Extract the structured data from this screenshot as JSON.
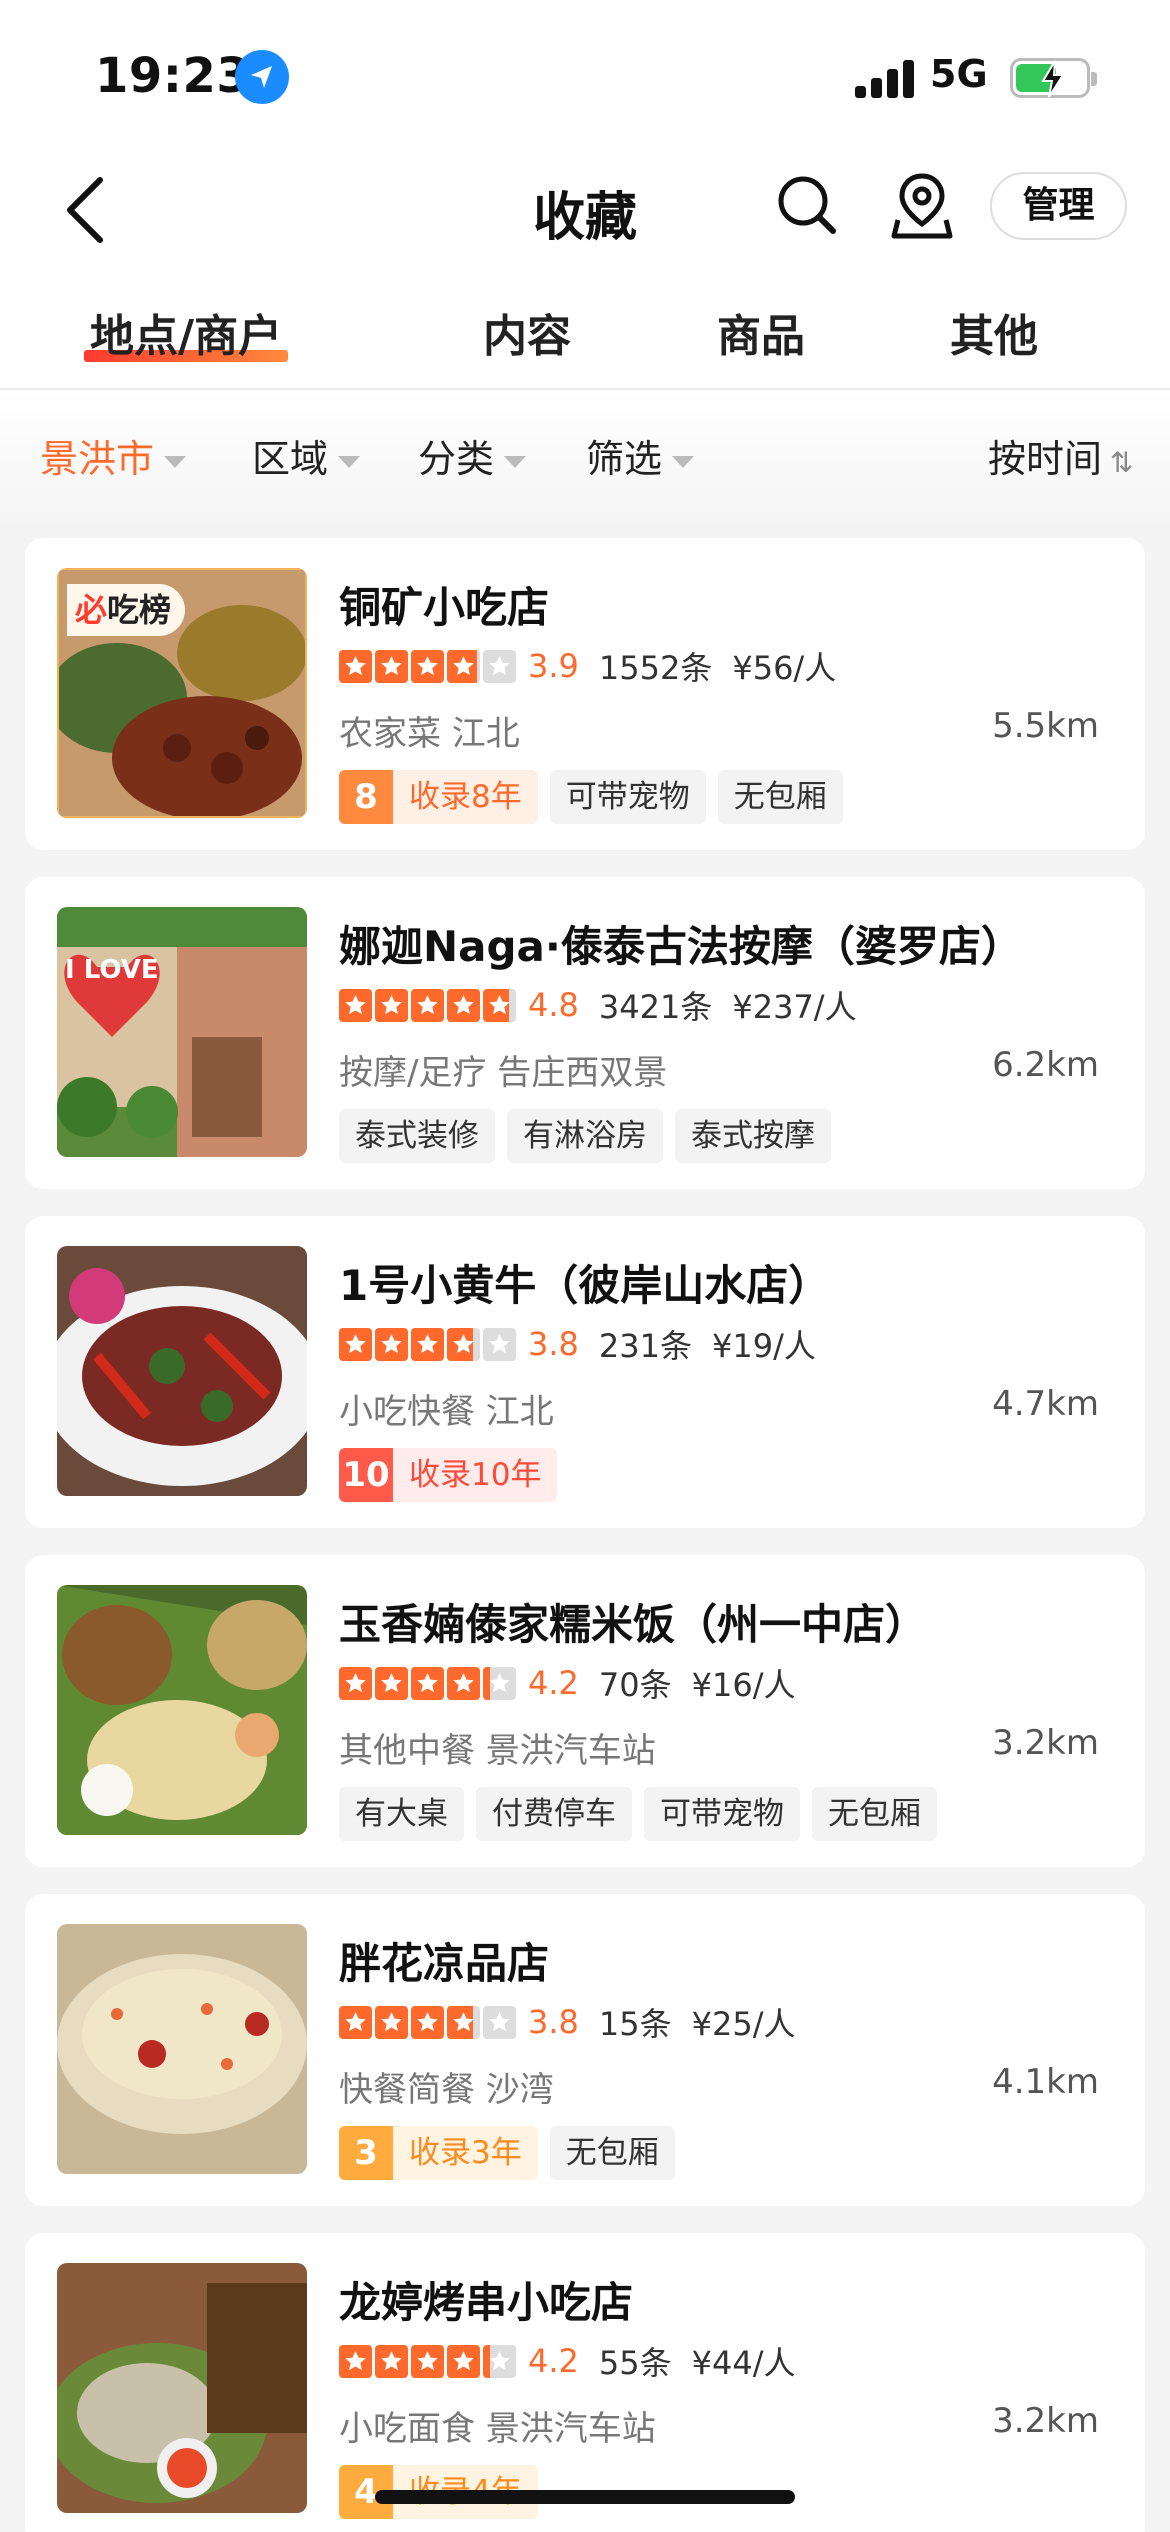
{
  "status_bar": {
    "time": "19:23",
    "network": "5G",
    "location_icon": "location-arrow-icon",
    "signal_icon": "signal-bars-icon",
    "battery_icon": "battery-charging-icon"
  },
  "nav": {
    "title": "收藏",
    "manage_label": "管理",
    "back_icon": "back-chevron-icon",
    "search_icon": "search-icon",
    "map_icon": "map-pin-icon"
  },
  "tabs": [
    {
      "label": "地点/商户",
      "active": true
    },
    {
      "label": "内容",
      "active": false
    },
    {
      "label": "商品",
      "active": false
    },
    {
      "label": "其他",
      "active": false
    }
  ],
  "filters": [
    {
      "label": "景洪市",
      "active": true
    },
    {
      "label": "区域",
      "active": false
    },
    {
      "label": "分类",
      "active": false
    },
    {
      "label": "筛选",
      "active": false
    }
  ],
  "sort": {
    "label": "按时间",
    "icon": "sort-arrows-icon"
  },
  "colors": {
    "accent": "#ff6a2c",
    "brand_red": "#ff3b2f",
    "background": "#f4f4f4"
  },
  "listings": [
    {
      "name": "铜矿小吃店",
      "rating": 3.9,
      "rating_text": "3.9",
      "reviews": "1552条",
      "price": "¥56/人",
      "category": "农家菜 江北",
      "distance": "5.5km",
      "rank_badge": {
        "prefix": "必",
        "text": "吃榜"
      },
      "years_tag": {
        "num": "8",
        "label": "收录8年",
        "color": "#ff8a3d",
        "bg": "#fff0e6",
        "text_color": "#ff6a2c"
      },
      "tags": [
        "可带宠物",
        "无包厢"
      ]
    },
    {
      "name": "娜迦Naga·傣泰古法按摩（婆罗店）",
      "rating": 4.8,
      "rating_text": "4.8",
      "reviews": "3421条",
      "price": "¥237/人",
      "category": "按摩/足疗 告庄西双景",
      "distance": "6.2km",
      "thumb_text": "I LOVE",
      "tags": [
        "泰式装修",
        "有淋浴房",
        "泰式按摩"
      ]
    },
    {
      "name": "1号小黄牛（彼岸山水店）",
      "rating": 3.8,
      "rating_text": "3.8",
      "reviews": "231条",
      "price": "¥19/人",
      "category": "小吃快餐 江北",
      "distance": "4.7km",
      "years_tag": {
        "num": "10",
        "label": "收录10年",
        "color": "#ff5a4a",
        "bg": "#ffeceb",
        "text_color": "#ff4a3a"
      },
      "tags": []
    },
    {
      "name": "玉香婻傣家糯米饭（州一中店）",
      "rating": 4.2,
      "rating_text": "4.2",
      "reviews": "70条",
      "price": "¥16/人",
      "category": "其他中餐 景洪汽车站",
      "distance": "3.2km",
      "tags": [
        "有大桌",
        "付费停车",
        "可带宠物",
        "无包厢"
      ]
    },
    {
      "name": "胖花凉品店",
      "rating": 3.8,
      "rating_text": "3.8",
      "reviews": "15条",
      "price": "¥25/人",
      "category": "快餐简餐 沙湾",
      "distance": "4.1km",
      "years_tag": {
        "num": "3",
        "label": "收录3年",
        "color": "#ffab3d",
        "bg": "#fff4e2",
        "text_color": "#ff8a1d"
      },
      "tags": [
        "无包厢"
      ]
    },
    {
      "name": "龙婷烤串小吃店",
      "rating": 4.2,
      "rating_text": "4.2",
      "reviews": "55条",
      "price": "¥44/人",
      "category": "小吃面食 景洪汽车站",
      "distance": "3.2km",
      "years_tag": {
        "num": "4",
        "label": "收录4年",
        "color": "#ffab3d",
        "bg": "#fff4e2",
        "text_color": "#ff8a1d"
      },
      "tags": []
    }
  ]
}
